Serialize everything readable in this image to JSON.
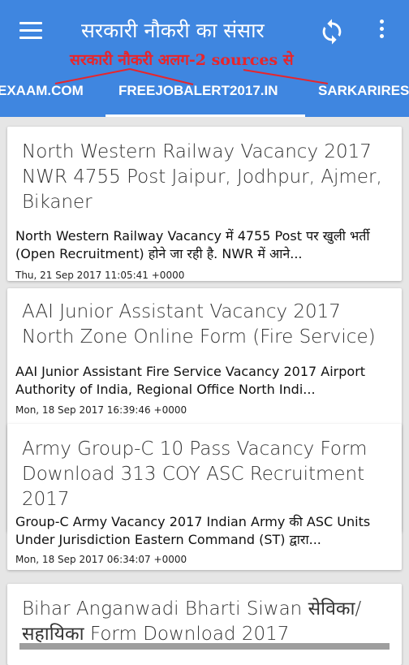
{
  "header": {
    "title": "सरकारी नौकरी का संसार",
    "annotation": "सरकारी नौकरी अलग-2 sources से",
    "colors": {
      "appbar": "#3f86e0",
      "annotation": "#e8252b"
    },
    "icons": {
      "menu": "menu-icon",
      "refresh": "refresh-icon",
      "more": "more-vert-icon"
    }
  },
  "tabs": [
    {
      "label": "EXAAM.COM"
    },
    {
      "label": "FREEJOBALERT2017.IN",
      "selected": true
    },
    {
      "label": "SARKARIRES"
    }
  ],
  "articles": [
    {
      "title": "North Western Railway Vacancy 2017 NWR 4755 Post Jaipur, Jodhpur, Ajmer, Bikaner",
      "description": "North Western Railway Vacancy में 4755 Post पर खुली भर्ती (Open Recruitment) होने जा रही है. NWR में आने...",
      "date": "Thu, 21 Sep 2017 11:05:41 +0000"
    },
    {
      "title": "AAI Junior Assistant Vacancy 2017 North Zone Online Form (Fire Service)",
      "description": "AAI Junior Assistant Fire Service Vacancy 2017 Airport Authority of India, Regional Office North Indi...",
      "date": "Mon, 18 Sep 2017 16:39:46 +0000"
    },
    {
      "title": "Army Group-C 10 Pass Vacancy Form Download 313 COY ASC Recruitment 2017",
      "description": "Group-C Army Vacancy 2017 Indian Army की ASC Units Under Jurisdiction Eastern Command (ST) द्वारा...",
      "date": "Mon, 18 Sep 2017 06:34:07 +0000"
    },
    {
      "title": "Bihar Anganwadi Bharti Siwan सेविका/सहायिका Form Download 2017",
      "description": "",
      "date": ""
    }
  ]
}
